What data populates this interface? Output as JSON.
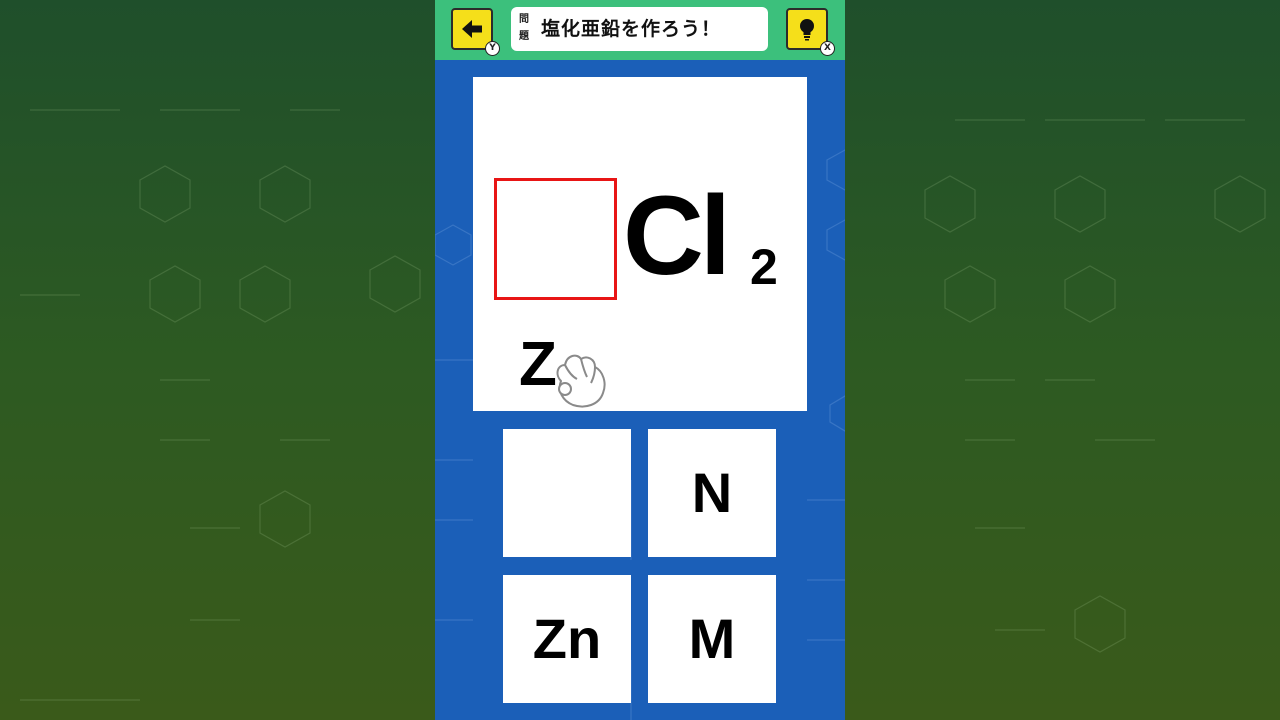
{
  "header": {
    "question_label": "問題",
    "question_text": "塩化亜鉛を作ろう！",
    "back_key": "Y",
    "hint_key": "X"
  },
  "formula": {
    "symbol": "Cl",
    "subscript": "2",
    "dragging_letter": "Z"
  },
  "tiles": [
    "",
    "N",
    "Zn",
    "M"
  ],
  "colors": {
    "topbar": "#3cc07c",
    "panel": "#1b5fb8",
    "button": "#f5df1a",
    "slot_border": "#e81515"
  }
}
